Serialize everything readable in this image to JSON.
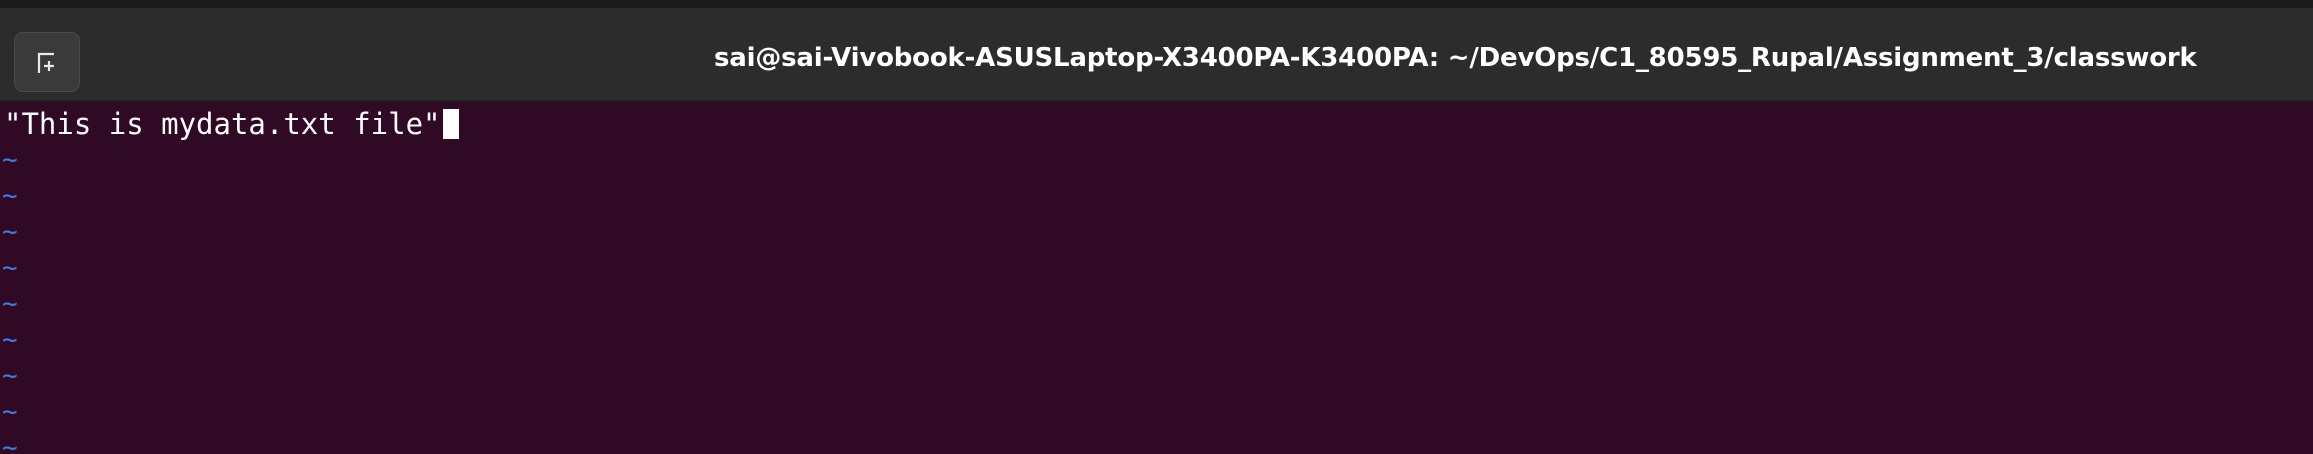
{
  "window": {
    "title": "sai@sai-Vivobook-ASUSLaptop-X3400PA-K3400PA: ~/DevOps/C1_80595_Rupal/Assignment_3/classwork",
    "new_tab_icon": "new-tab-icon"
  },
  "editor": {
    "lines": [
      "\"This is mydata.txt file\""
    ],
    "empty_line_marker": "~",
    "empty_line_count": 9
  },
  "colors": {
    "terminal_background": "#300a24",
    "titlebar_background": "#2c2c2c",
    "tilde_color": "#3d7fe0",
    "text_color": "#ffffff"
  }
}
